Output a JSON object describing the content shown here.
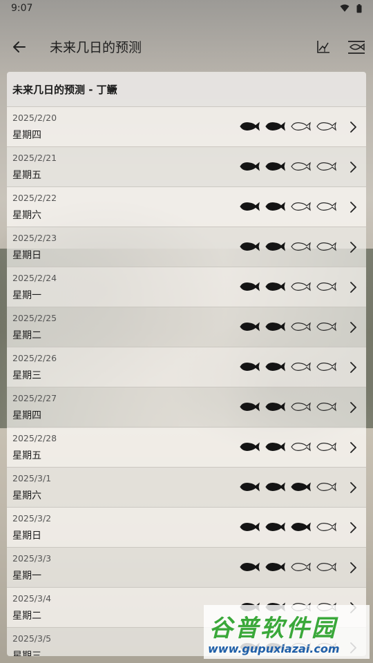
{
  "status_bar": {
    "time": "9:07"
  },
  "app_bar": {
    "title": "未来几日的预测"
  },
  "card": {
    "header": "未来几日的预测 - 丁鳜"
  },
  "days": [
    {
      "date": "2025/2/20",
      "weekday": "星期四",
      "rating": 2
    },
    {
      "date": "2025/2/21",
      "weekday": "星期五",
      "rating": 2
    },
    {
      "date": "2025/2/22",
      "weekday": "星期六",
      "rating": 2
    },
    {
      "date": "2025/2/23",
      "weekday": "星期日",
      "rating": 2
    },
    {
      "date": "2025/2/24",
      "weekday": "星期一",
      "rating": 2
    },
    {
      "date": "2025/2/25",
      "weekday": "星期二",
      "rating": 2
    },
    {
      "date": "2025/2/26",
      "weekday": "星期三",
      "rating": 2
    },
    {
      "date": "2025/2/27",
      "weekday": "星期四",
      "rating": 2
    },
    {
      "date": "2025/2/28",
      "weekday": "星期五",
      "rating": 2
    },
    {
      "date": "2025/3/1",
      "weekday": "星期六",
      "rating": 3
    },
    {
      "date": "2025/3/2",
      "weekday": "星期日",
      "rating": 3
    },
    {
      "date": "2025/3/3",
      "weekday": "星期一",
      "rating": 2
    },
    {
      "date": "2025/3/4",
      "weekday": "星期二",
      "rating": 2
    },
    {
      "date": "2025/3/5",
      "weekday": "星期三",
      "rating": 2
    }
  ],
  "rating_max": 4,
  "icons": {
    "back": "arrow-left-icon",
    "chart": "chart-icon",
    "fish_menu": "fish-menu-icon",
    "fish_filled": "fish-filled-icon",
    "fish_outline": "fish-outline-icon",
    "chevron": "chevron-right-icon"
  },
  "watermark": {
    "cn": "谷普软件园",
    "url": "www.gupuxiazai.com"
  }
}
